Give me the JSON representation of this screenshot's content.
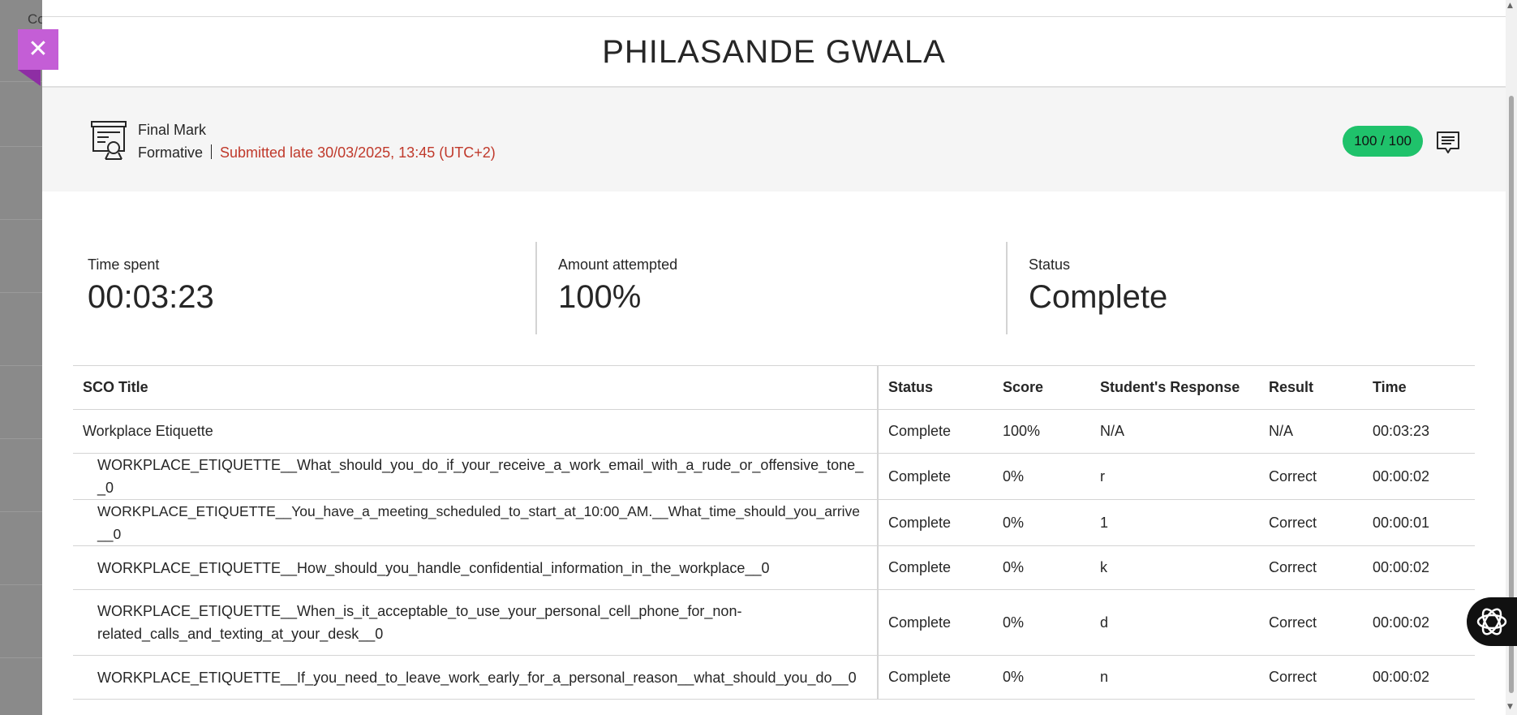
{
  "background": {
    "partial_text": "Co"
  },
  "close": {
    "label": "✕"
  },
  "dialog": {
    "title": "PHILASANDE GWALA"
  },
  "grade": {
    "name": "Final Mark",
    "category": "Formative",
    "submission": "Submitted late 30/03/2025, 13:45 (UTC+2)",
    "score": "100 / 100",
    "score_color": "#1fc26b",
    "late_color": "#c0392b",
    "icon": "certificate-icon",
    "feedback_icon": "comment-icon"
  },
  "stats": {
    "time_spent": {
      "label": "Time spent",
      "value": "00:03:23"
    },
    "amount_attempted": {
      "label": "Amount attempted",
      "value": "100%"
    },
    "status": {
      "label": "Status",
      "value": "Complete"
    }
  },
  "table": {
    "headers": [
      "SCO Title",
      "Status",
      "Score",
      "Student's Response",
      "Result",
      "Time"
    ],
    "rows": [
      [
        "Workplace Etiquette",
        "Complete",
        "100%",
        "N/A",
        "N/A",
        "00:03:23"
      ],
      [
        "WORKPLACE_ETIQUETTE__What_should_you_do_if_your_receive_a_work_email_with_a_rude_or_offensive_tone__0",
        "Complete",
        "0%",
        "r",
        "Correct",
        "00:00:02"
      ],
      [
        "WORKPLACE_ETIQUETTE__You_have_a_meeting_scheduled_to_start_at_10:00_AM.__What_time_should_you_arrive__0",
        "Complete",
        "0%",
        "1",
        "Correct",
        "00:00:01"
      ],
      [
        "WORKPLACE_ETIQUETTE__How_should_you_handle_confidential_information_in_the_workplace__0",
        "Complete",
        "0%",
        "k",
        "Correct",
        "00:00:02"
      ],
      [
        "WORKPLACE_ETIQUETTE__When_is_it_acceptable_to_use_your_personal_cell_phone_for_non-related_calls_and_texting_at_your_desk__0",
        "Complete",
        "0%",
        "d",
        "Correct",
        "00:00:02"
      ],
      [
        "WORKPLACE_ETIQUETTE__If_you_need_to_leave_work_early_for_a_personal_reason__what_should_you_do__0",
        "Complete",
        "0%",
        "n",
        "Correct",
        "00:00:02"
      ]
    ]
  },
  "assistant": {
    "icon": "ai-assistant-icon"
  }
}
